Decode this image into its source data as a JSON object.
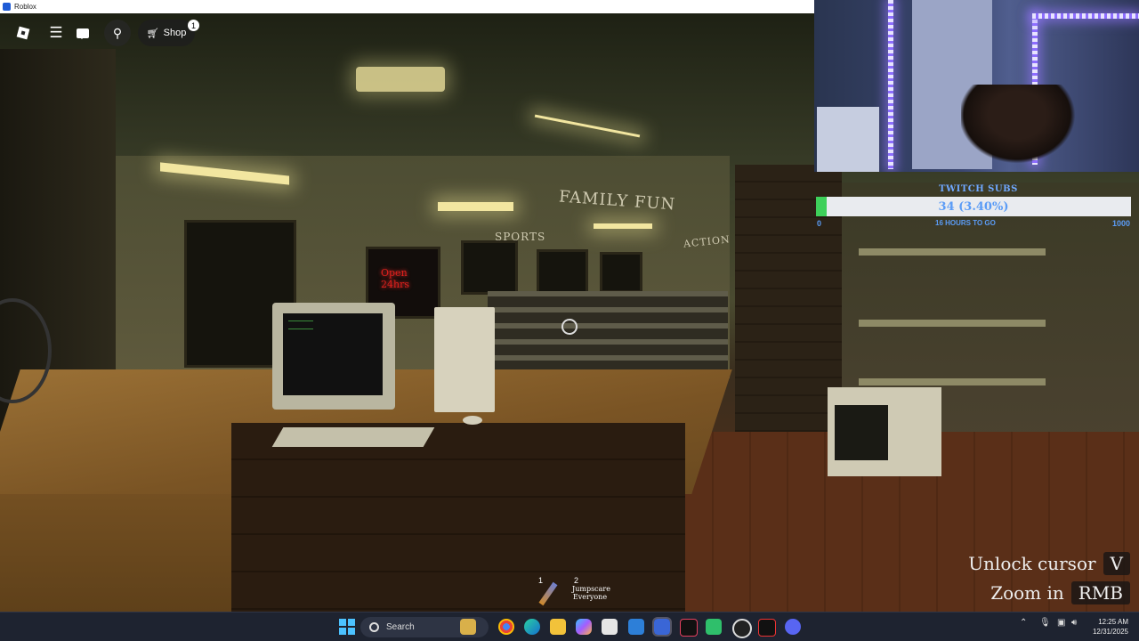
{
  "window": {
    "title": "Roblox"
  },
  "roblox_topbar": {
    "shop_label": "Shop",
    "shop_badge": "1"
  },
  "scene": {
    "signs": {
      "family_fun": "FAMILY FUN",
      "sports": "SPORTS",
      "action": "ACTION"
    },
    "neon_sign": {
      "line1": "Open",
      "line2": "24hrs"
    }
  },
  "twitch_subs": {
    "title": "TWITCH SUBS",
    "progress_text": "34 (3.40%)",
    "progress_fraction": 0.034,
    "min": "0",
    "max": "1000",
    "time_to_go": "16 HOURS TO GO",
    "fill_color": "#3ed05a",
    "text_color": "#5b9cf6"
  },
  "hints": [
    {
      "label": "Unlock cursor",
      "key": "V"
    },
    {
      "label": "Zoom in",
      "key": "RMB"
    }
  ],
  "hotbar": [
    {
      "num": "1",
      "icon": "flashlight-tool-icon",
      "label": ""
    },
    {
      "num": "2",
      "icon": "",
      "label": "Jumpscare Everyone"
    }
  ],
  "taskbar": {
    "search_placeholder": "Search",
    "apps": [
      "file-explorer-icon",
      "chrome-icon",
      "edge-icon",
      "files-icon",
      "copilot-icon",
      "store-icon",
      "mail-icon",
      "roblox-icon",
      "tiktok-icon",
      "xbox-icon",
      "obs-icon",
      "game-icon",
      "discord-icon"
    ],
    "tray_time": "12:25 AM",
    "tray_date": "12/31/2025"
  }
}
